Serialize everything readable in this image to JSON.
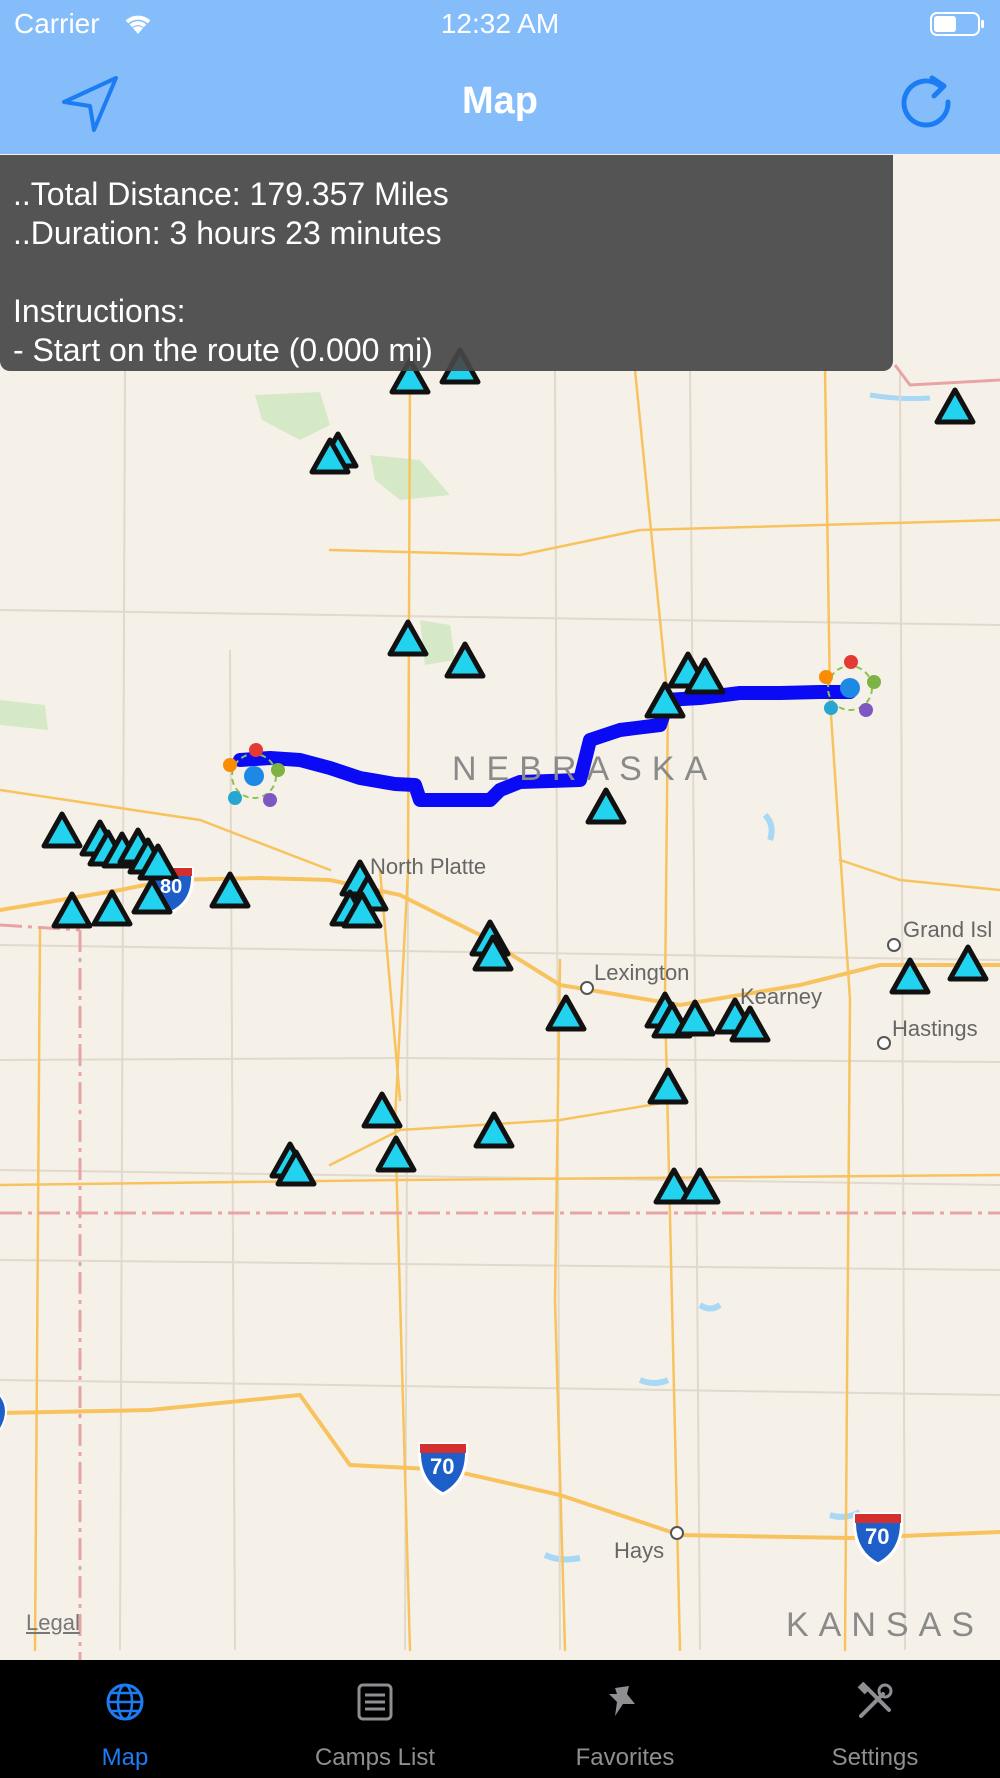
{
  "status_bar": {
    "carrier": "Carrier",
    "time": "12:32 AM"
  },
  "nav": {
    "title": "Map",
    "left_icon": "location-arrow-icon",
    "right_icon": "refresh-icon"
  },
  "info_panel": {
    "lines": [
      "..Total Distance: 179.357 Miles",
      "..Duration: 3 hours 23 minutes",
      "",
      "Instructions:",
      "- Start on the route (0.000 mi)"
    ]
  },
  "map": {
    "state_labels": [
      "NEBRASKA",
      "KANSAS"
    ],
    "city_labels": [
      "North Platte",
      "Lexington",
      "Kearney",
      "Grand Isl",
      "Hastings",
      "Hays"
    ],
    "highway_shields": [
      "80",
      "70",
      "70"
    ],
    "legal": "Legal",
    "colors": {
      "route": "#0a0af5",
      "campsite": "#22d3f0",
      "road": "#f8c35e",
      "water": "#a8d8f5",
      "park": "#d6e9c6"
    }
  },
  "tabs": [
    {
      "label": "Map",
      "icon": "globe-icon",
      "active": true
    },
    {
      "label": "Camps List",
      "icon": "list-icon",
      "active": false
    },
    {
      "label": "Favorites",
      "icon": "pin-icon",
      "active": false
    },
    {
      "label": "Settings",
      "icon": "tools-icon",
      "active": false
    }
  ],
  "accent_color": "#1c7cf4",
  "nav_background": "#85bdfb"
}
